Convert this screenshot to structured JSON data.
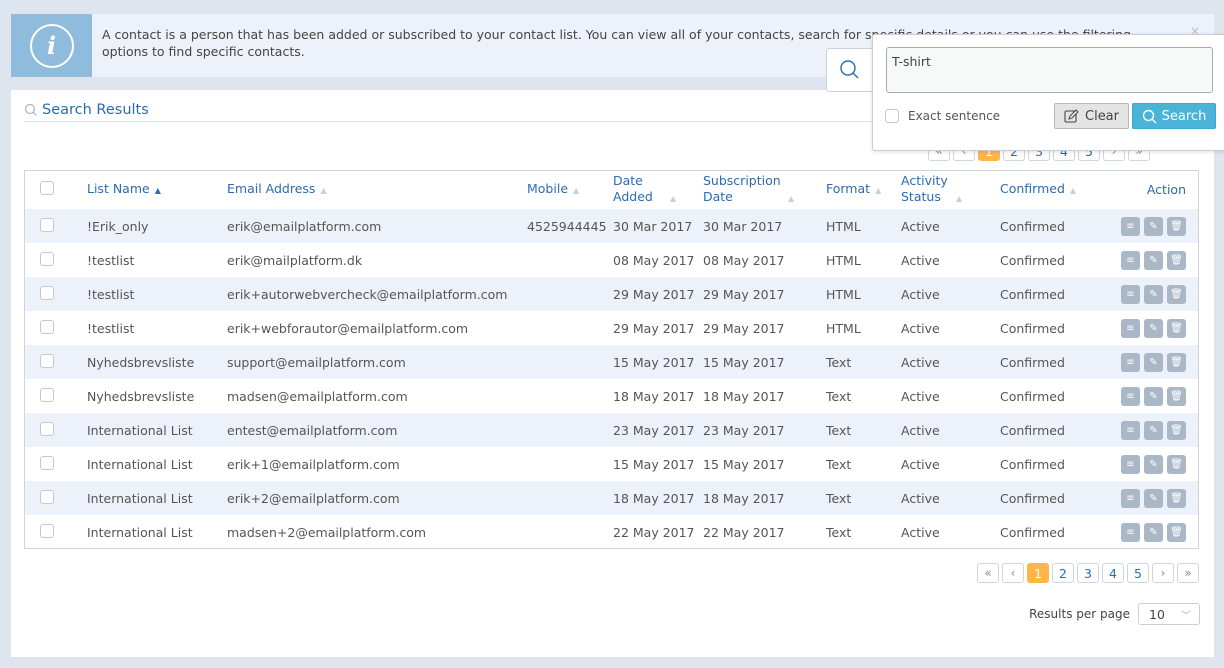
{
  "banner": {
    "icon": "info-icon",
    "text": "A contact is a person that has been added or subscribed to your contact list. You can view all of your contacts, search for specific details or you can use the filtering options to find specific contacts.",
    "close_label": "×"
  },
  "results": {
    "title": "Search Results"
  },
  "search_popover": {
    "query": "T-shirt",
    "exact_sentence_label": "Exact sentence",
    "clear_label": "Clear",
    "search_label": "Search"
  },
  "table": {
    "columns": [
      {
        "label": "List Name",
        "sorted": "asc"
      },
      {
        "label": "Email Address"
      },
      {
        "label": "Mobile"
      },
      {
        "label": "Date Added"
      },
      {
        "label": "Subscription Date"
      },
      {
        "label": "Format"
      },
      {
        "label": "Activity Status"
      },
      {
        "label": "Confirmed"
      },
      {
        "label": "Action"
      }
    ],
    "rows": [
      {
        "list": "!Erik_only",
        "email": "erik@emailplatform.com",
        "mobile": "4525944445",
        "added": "30 Mar 2017",
        "subscribed": "30 Mar 2017",
        "format": "HTML",
        "status": "Active",
        "confirmed": "Confirmed"
      },
      {
        "list": "!testlist",
        "email": "erik@mailplatform.dk",
        "mobile": "",
        "added": "08 May 2017",
        "subscribed": "08 May 2017",
        "format": "HTML",
        "status": "Active",
        "confirmed": "Confirmed"
      },
      {
        "list": "!testlist",
        "email": "erik+autorwebvercheck@emailplatform.com",
        "mobile": "",
        "added": "29 May 2017",
        "subscribed": "29 May 2017",
        "format": "HTML",
        "status": "Active",
        "confirmed": "Confirmed"
      },
      {
        "list": "!testlist",
        "email": "erik+webforautor@emailplatform.com",
        "mobile": "",
        "added": "29 May 2017",
        "subscribed": "29 May 2017",
        "format": "HTML",
        "status": "Active",
        "confirmed": "Confirmed"
      },
      {
        "list": "Nyhedsbrevsliste",
        "email": "support@emailplatform.com",
        "mobile": "",
        "added": "15 May 2017",
        "subscribed": "15 May 2017",
        "format": "Text",
        "status": "Active",
        "confirmed": "Confirmed"
      },
      {
        "list": "Nyhedsbrevsliste",
        "email": "madsen@emailplatform.com",
        "mobile": "",
        "added": "18 May 2017",
        "subscribed": "18 May 2017",
        "format": "Text",
        "status": "Active",
        "confirmed": "Confirmed"
      },
      {
        "list": "International List",
        "email": "entest@emailplatform.com",
        "mobile": "",
        "added": "23 May 2017",
        "subscribed": "23 May 2017",
        "format": "Text",
        "status": "Active",
        "confirmed": "Confirmed"
      },
      {
        "list": "International List",
        "email": "erik+1@emailplatform.com",
        "mobile": "",
        "added": "15 May 2017",
        "subscribed": "15 May 2017",
        "format": "Text",
        "status": "Active",
        "confirmed": "Confirmed"
      },
      {
        "list": "International List",
        "email": "erik+2@emailplatform.com",
        "mobile": "",
        "added": "18 May 2017",
        "subscribed": "18 May 2017",
        "format": "Text",
        "status": "Active",
        "confirmed": "Confirmed"
      },
      {
        "list": "International List",
        "email": "madsen+2@emailplatform.com",
        "mobile": "",
        "added": "22 May 2017",
        "subscribed": "22 May 2017",
        "format": "Text",
        "status": "Active",
        "confirmed": "Confirmed"
      }
    ],
    "row_actions": [
      "view-icon",
      "edit-icon",
      "delete-icon"
    ]
  },
  "pagination": {
    "first": "«",
    "prev": "‹",
    "pages": [
      "1",
      "2",
      "3",
      "4",
      "5"
    ],
    "current": "1",
    "next": "›",
    "last": "»"
  },
  "results_per_page": {
    "label": "Results per page",
    "value": "10"
  },
  "colors": {
    "accent": "#2b6cb0",
    "active_page": "#ffb547",
    "search_button": "#4ab3d8",
    "info_icon_bg": "#8fbcdc"
  }
}
